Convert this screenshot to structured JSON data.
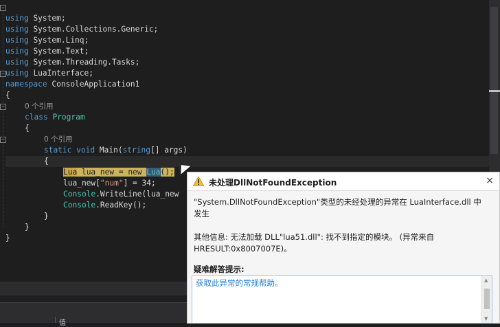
{
  "code": {
    "lines": [
      {
        "indent": "",
        "parts": [
          [
            "kw",
            "using"
          ],
          [
            "",
            "&nbsp;"
          ],
          [
            "",
            "System;"
          ]
        ]
      },
      {
        "indent": "",
        "parts": [
          [
            "kw",
            "using"
          ],
          [
            "",
            "&nbsp;"
          ],
          [
            "",
            "System.Collections.Generic;"
          ]
        ]
      },
      {
        "indent": "",
        "parts": [
          [
            "kw",
            "using"
          ],
          [
            "",
            "&nbsp;"
          ],
          [
            "",
            "System.Linq;"
          ]
        ]
      },
      {
        "indent": "",
        "parts": [
          [
            "kw",
            "using"
          ],
          [
            "",
            "&nbsp;"
          ],
          [
            "",
            "System.Text;"
          ]
        ]
      },
      {
        "indent": "",
        "parts": [
          [
            "kw",
            "using"
          ],
          [
            "",
            "&nbsp;"
          ],
          [
            "",
            "System.Threading.Tasks;"
          ]
        ]
      },
      {
        "indent": "",
        "parts": [
          [
            "kw",
            "using"
          ],
          [
            "",
            "&nbsp;"
          ],
          [
            "",
            "LuaInterface;"
          ]
        ]
      }
    ],
    "text": {
      "l1_kw": "using",
      "l1": "System;",
      "l2_kw": "using",
      "l2": "System.Collections.Generic;",
      "l3_kw": "using",
      "l3": "System.Linq;",
      "l4_kw": "using",
      "l4": "System.Text;",
      "l5_kw": "using",
      "l5": "System.Threading.Tasks;",
      "l6_kw": "using",
      "l6": "LuaInterface;",
      "l7_kw": "namespace",
      "l7": "ConsoleApplication1",
      "l8": "{",
      "ref1": "0 个引用",
      "l10_kw": "class",
      "l10_ty": "Program",
      "l11": "{",
      "ref2": "0 个引用",
      "l13_kw1": "static",
      "l13_kw2": "void",
      "l13_a": "Main(",
      "l13_kw3": "string",
      "l13_b": "[] args)",
      "l14": "{",
      "l15_ty1": "Lua",
      "l15_a": " lua_new = ",
      "l15_kw": "new",
      "l15_b": " ",
      "l15_ty2": "Lua",
      "l15_c": "();",
      "l16_a": "lua_new[",
      "l16_str": "\"num\"",
      "l16_b": "] = 34;",
      "l17_ty": "Console",
      "l17_a": ".WriteLine(lua_new",
      "l18_ty": "Console",
      "l18_a": ".ReadKey();",
      "l19": "}",
      "l20": "}",
      "l21": "}"
    }
  },
  "exception": {
    "title": "未处理DllNotFoundException",
    "message": "\"System.DllNotFoundException\"类型的未经处理的异常在 LuaInterface.dll 中发生",
    "info": "其他信息: 无法加载 DLL\"lua51.dll\": 找不到指定的模块。 (异常来自 HRESULT:0x8007007E)。",
    "tips_label": "疑难解答提示:",
    "tip_link": "获取此异常的常规帮助。",
    "close_label": "×"
  },
  "bottom": {
    "label": "值"
  },
  "colors": {
    "keyword": "#569cd6",
    "type": "#4ec9b0",
    "string": "#d69d85",
    "link": "#1e7bd6",
    "background": "#1e1e1e"
  }
}
